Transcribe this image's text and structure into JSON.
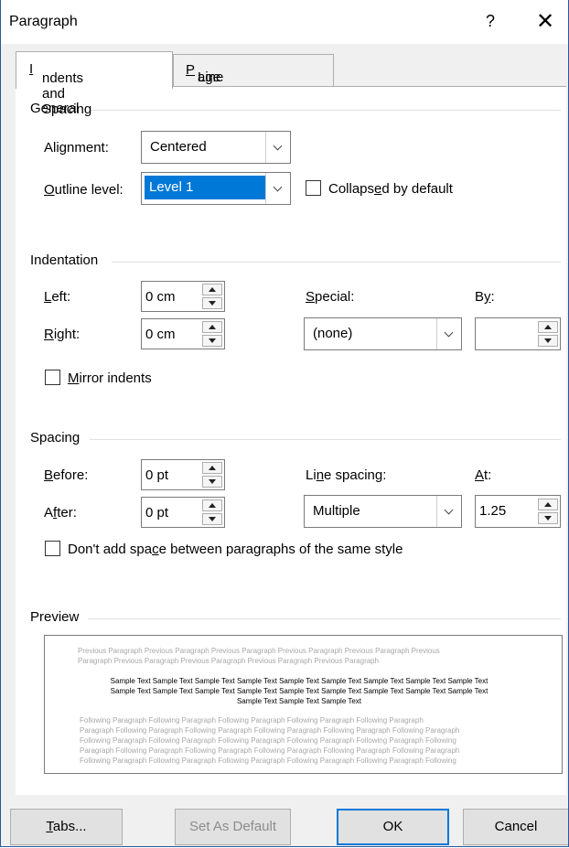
{
  "window": {
    "title": "Paragraph",
    "help_glyph": "?",
    "close_glyph": "✕"
  },
  "tabs": [
    {
      "label_pre": "",
      "label_u": "I",
      "label_post": "ndents and Spacing",
      "active": true
    },
    {
      "label_pre": "Line and ",
      "label_u": "P",
      "label_post": "age Breaks",
      "active": false
    }
  ],
  "general": {
    "heading": "General",
    "alignment": {
      "label_pre": "Ali",
      "label_u": "g",
      "label_post": "nment:",
      "value": "Centered"
    },
    "outline": {
      "label_pre": "",
      "label_u": "O",
      "label_post": "utline level:",
      "value": "Level 1"
    },
    "collapsed": {
      "label_pre": "Collaps",
      "label_u": "e",
      "label_post": "d by default",
      "checked": false
    }
  },
  "indentation": {
    "heading": "Indentation",
    "left": {
      "label_pre": "",
      "label_u": "L",
      "label_post": "eft:",
      "value": "0 cm"
    },
    "right": {
      "label_pre": "",
      "label_u": "R",
      "label_post": "ight:",
      "value": "0 cm"
    },
    "special": {
      "label_pre": "",
      "label_u": "S",
      "label_post": "pecial:",
      "value": "(none)"
    },
    "by": {
      "label_pre": "B",
      "label_u": "y",
      "label_post": ":",
      "value": ""
    },
    "mirror": {
      "label_pre": "",
      "label_u": "M",
      "label_post": "irror indents",
      "checked": false
    }
  },
  "spacing": {
    "heading": "Spacing",
    "before": {
      "label_pre": "",
      "label_u": "B",
      "label_post": "efore:",
      "value": "0 pt"
    },
    "after": {
      "label_pre": "A",
      "label_u": "f",
      "label_post": "ter:",
      "value": "0 pt"
    },
    "line_spacing": {
      "label_pre": "Li",
      "label_u": "n",
      "label_post": "e spacing:",
      "value": "Multiple"
    },
    "at": {
      "label_pre": "",
      "label_u": "A",
      "label_post": "t:",
      "value": "1.25"
    },
    "dont_add": {
      "label_pre": "Don't add spa",
      "label_u": "c",
      "label_post": "e between paragraphs of the same style",
      "checked": false
    }
  },
  "preview": {
    "heading": "Preview",
    "previous": [
      "Previous Paragraph Previous Paragraph Previous Paragraph Previous Paragraph Previous Paragraph Previous",
      "Paragraph Previous Paragraph Previous Paragraph Previous Paragraph Previous Paragraph"
    ],
    "sample": [
      "Sample Text Sample Text Sample Text Sample Text Sample Text Sample Text Sample Text Sample Text Sample Text",
      "Sample Text Sample Text Sample Text Sample Text Sample Text Sample Text Sample Text Sample Text Sample Text",
      "Sample Text Sample Text Sample Text"
    ],
    "following": [
      "Following Paragraph Following Paragraph Following Paragraph Following Paragraph Following Paragraph",
      "Paragraph Following Paragraph Following Paragraph Following Paragraph Following Paragraph Following Paragraph",
      "Following Paragraph Following Paragraph Following Paragraph Following Paragraph Following Paragraph Following",
      "Paragraph Following Paragraph Following Paragraph Following Paragraph Following Paragraph Following Paragraph",
      "Following Paragraph Following Paragraph Following Paragraph Following Paragraph Following Paragraph Following"
    ]
  },
  "buttons": {
    "tabs": {
      "label_pre": "",
      "label_u": "T",
      "label_post": "abs..."
    },
    "set_default": "Set As Default",
    "ok": "OK",
    "cancel": "Cancel"
  },
  "colors": {
    "accent": "#0078d7",
    "border": "#2b579a"
  }
}
